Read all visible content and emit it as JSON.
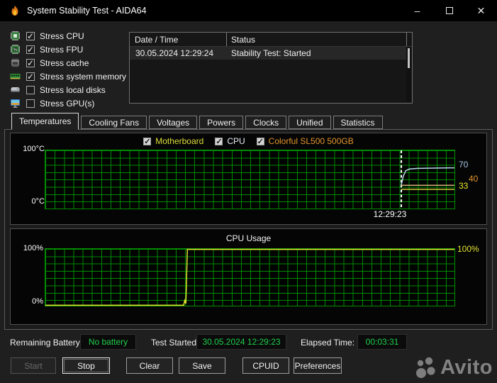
{
  "window": {
    "title": "System Stability Test - AIDA64",
    "controls": {
      "minimize": "–",
      "close": "✕"
    }
  },
  "stress_options": [
    {
      "label": "Stress CPU",
      "icon": "cpu-chip-icon",
      "checked": true
    },
    {
      "label": "Stress FPU",
      "icon": "fpu-chip-icon",
      "checked": true
    },
    {
      "label": "Stress cache",
      "icon": "cache-chip-icon",
      "checked": true
    },
    {
      "label": "Stress system memory",
      "icon": "memory-module-icon",
      "checked": true
    },
    {
      "label": "Stress local disks",
      "icon": "hard-disk-icon",
      "checked": false
    },
    {
      "label": "Stress GPU(s)",
      "icon": "gpu-monitor-icon",
      "checked": false
    }
  ],
  "log_table": {
    "columns": [
      "Date / Time",
      "Status"
    ],
    "rows": [
      {
        "datetime": "30.05.2024 12:29:24",
        "status": "Stability Test: Started"
      }
    ]
  },
  "tabs": [
    {
      "label": "Temperatures",
      "active": true
    },
    {
      "label": "Cooling Fans",
      "active": false
    },
    {
      "label": "Voltages",
      "active": false
    },
    {
      "label": "Powers",
      "active": false
    },
    {
      "label": "Clocks",
      "active": false
    },
    {
      "label": "Unified",
      "active": false
    },
    {
      "label": "Statistics",
      "active": false
    }
  ],
  "status_bar": {
    "battery_label": "Remaining Battery:",
    "battery_value": "No battery",
    "test_started_label": "Test Started:",
    "test_started_value": "30.05.2024 12:29:23",
    "elapsed_label": "Elapsed Time:",
    "elapsed_value": "00:03:31"
  },
  "action_buttons": [
    {
      "label": "Start",
      "enabled": false,
      "default": false
    },
    {
      "label": "Stop",
      "enabled": true,
      "default": true
    },
    {
      "label": "Clear",
      "enabled": true,
      "default": false
    },
    {
      "label": "Save",
      "enabled": true,
      "default": false
    },
    {
      "label": "CPUID",
      "enabled": true,
      "default": false
    },
    {
      "label": "Preferences",
      "enabled": true,
      "default": false
    }
  ],
  "watermark": {
    "text": "Avito"
  },
  "chart_data": [
    {
      "type": "line",
      "title": "Temperatures",
      "ylabel_top": "100°C",
      "ylabel_bottom": "0°C",
      "ylim": [
        0,
        100
      ],
      "grid": true,
      "legend": [
        {
          "label": "Motherboard",
          "color": "#dede3a",
          "checked": true
        },
        {
          "label": "CPU",
          "color": "#e8eef5",
          "checked": true
        },
        {
          "label": "Colorful SL500 500GB",
          "color": "#e2952e",
          "checked": true
        }
      ],
      "marker_t": 0.87,
      "marker_time_label": "12:29:23",
      "value_labels": [
        {
          "text": "70",
          "color": "#a6c6e6"
        },
        {
          "text": "40",
          "color": "#e2952e"
        },
        {
          "text": "33",
          "color": "#e8e832"
        }
      ],
      "series": [
        {
          "name": "CPU",
          "color": "#bdd7ec",
          "points": [
            {
              "t": 0.87,
              "v": 41
            },
            {
              "t": 0.875,
              "v": 56
            },
            {
              "t": 0.881,
              "v": 65
            },
            {
              "t": 0.89,
              "v": 68
            },
            {
              "t": 0.91,
              "v": 69
            },
            {
              "t": 0.95,
              "v": 69.5
            },
            {
              "t": 1,
              "v": 70
            }
          ]
        },
        {
          "name": "Colorful SL500 500GB",
          "color": "#d9ab76",
          "points": [
            {
              "t": 0.87,
              "v": 40
            },
            {
              "t": 1,
              "v": 40
            }
          ]
        },
        {
          "name": "Motherboard",
          "color": "#e3e33c",
          "points": [
            {
              "t": 0.87,
              "v": 33
            },
            {
              "t": 1,
              "v": 33
            }
          ]
        }
      ]
    },
    {
      "type": "line",
      "title": "CPU Usage",
      "ylabel_top": "100%",
      "ylabel_bottom": "0%",
      "right_label": "100%",
      "ylim": [
        0,
        100
      ],
      "grid": true,
      "series": [
        {
          "name": "CPU Usage",
          "color": "#e6e632",
          "points": [
            {
              "t": 0,
              "v": 0.8
            },
            {
              "t": 0.338,
              "v": 0.8
            },
            {
              "t": 0.3405,
              "v": 9
            },
            {
              "t": 0.3435,
              "v": 4
            },
            {
              "t": 0.347,
              "v": 99.2
            },
            {
              "t": 1,
              "v": 99.2
            }
          ]
        }
      ]
    }
  ]
}
